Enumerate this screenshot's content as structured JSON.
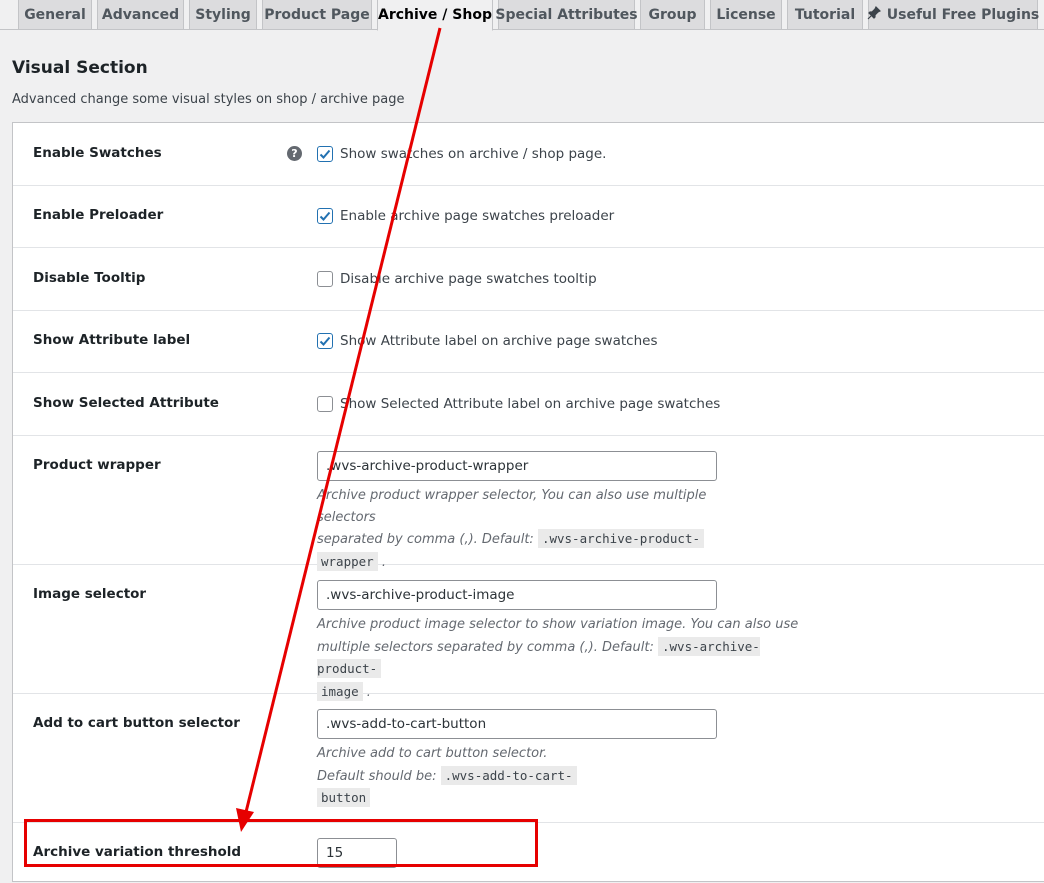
{
  "tabs": [
    {
      "label": "General"
    },
    {
      "label": "Advanced"
    },
    {
      "label": "Styling"
    },
    {
      "label": "Product Page"
    },
    {
      "label": "Archive / Shop"
    },
    {
      "label": "Special Attributes"
    },
    {
      "label": "Group"
    },
    {
      "label": "License"
    },
    {
      "label": "Tutorial"
    },
    {
      "label": "Useful Free Plugins"
    }
  ],
  "section": {
    "title": "Visual Section",
    "description": "Advanced change some visual styles on shop / archive page"
  },
  "settings": {
    "enable_swatches": {
      "label": "Enable Swatches",
      "checkbox_label": "Show swatches on archive / shop page.",
      "checked": true
    },
    "enable_preloader": {
      "label": "Enable Preloader",
      "checkbox_label": "Enable archive page swatches preloader",
      "checked": true
    },
    "disable_tooltip": {
      "label": "Disable Tooltip",
      "checkbox_label": "Disable archive page swatches tooltip",
      "checked": false
    },
    "show_attribute_label": {
      "label": "Show Attribute label",
      "checkbox_label": "Show Attribute label on archive page swatches",
      "checked": true
    },
    "show_selected_attribute": {
      "label": "Show Selected Attribute",
      "checkbox_label": "Show Selected Attribute label on archive page swatches",
      "checked": false
    },
    "product_wrapper": {
      "label": "Product wrapper",
      "value": ".wvs-archive-product-wrapper",
      "desc_line1": "Archive product wrapper selector, You can also use multiple selectors",
      "desc_line2": "separated by comma (,). Default:",
      "code_a": ".wvs-archive-product-",
      "code_b": "wrapper"
    },
    "image_selector": {
      "label": "Image selector",
      "value": ".wvs-archive-product-image",
      "desc_line1": "Archive product image selector to show variation image. You can also use",
      "desc_line2": "multiple selectors separated by comma (,). Default:",
      "code_a": ".wvs-archive-product-",
      "code_b": "image"
    },
    "add_to_cart_selector": {
      "label": "Add to cart button selector",
      "value": ".wvs-add-to-cart-button",
      "desc_line1": "Archive add to cart button selector.",
      "desc_line2": "Default should be:",
      "code_a": ".wvs-add-to-cart-",
      "code_b": "button"
    },
    "archive_variation_threshold": {
      "label": "Archive variation threshold",
      "value": "15"
    }
  },
  "icons": {
    "help": "question-circle-icon",
    "plugin": "plug-icon"
  },
  "colors": {
    "annotation": "#e60000",
    "checkbox_accent": "#2271b1"
  }
}
